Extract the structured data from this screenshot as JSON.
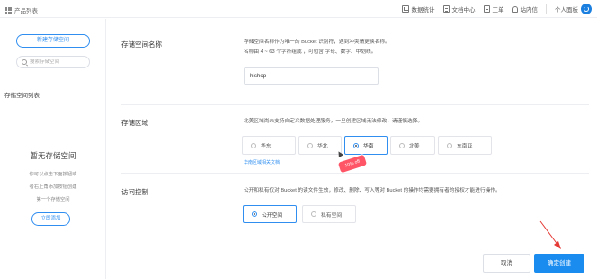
{
  "header": {
    "brand_label": "产品列表",
    "nav": [
      {
        "label": "数据统计",
        "icon": "chart-icon"
      },
      {
        "label": "文档中心",
        "icon": "document-icon"
      },
      {
        "label": "工单",
        "icon": "ticket-icon"
      },
      {
        "label": "站内信",
        "icon": "bell-icon"
      }
    ],
    "user_label": "个人面板"
  },
  "sidebar": {
    "new_button": "新建存储空间",
    "search_placeholder": "搜索存储空间",
    "list_title": "存储空间列表",
    "empty_title": "暂无存储空间",
    "empty_desc": [
      "你可以点击下面按钮或",
      "者右上角添加按钮创建",
      "第一个存储空间"
    ],
    "add_now": "立即添加"
  },
  "form": {
    "name": {
      "label": "存储空间名称",
      "desc": [
        "存储空间名称作为唯一的 Bucket 识别符，遇到冲突请更换名称。",
        "名称由 4 ~ 63 个字符组成 ，可包含 字母、数字、中划线。"
      ],
      "value": "hishop"
    },
    "region": {
      "label": "存储区域",
      "desc": "北美区域尚未支持自定义数据处理服务，一旦创建区域无法修改，请谨慎选择。",
      "options": [
        "华东",
        "华北",
        "华南",
        "北美",
        "东南亚"
      ],
      "selected": "华南",
      "link": "华南区域相关文档",
      "cursor_badge": "10% off"
    },
    "access": {
      "label": "访问控制",
      "desc": "公开和私有仅对 Bucket 的读文件生效，修改、删除、写入等对 Bucket 的操作均需要拥有者的授权才能进行操作。",
      "options": [
        "公开空间",
        "私有空间"
      ],
      "selected": "公开空间"
    },
    "cancel": "取消",
    "confirm": "确定创建"
  },
  "colors": {
    "accent": "#1a8cf0",
    "annotation": "#e53935"
  }
}
